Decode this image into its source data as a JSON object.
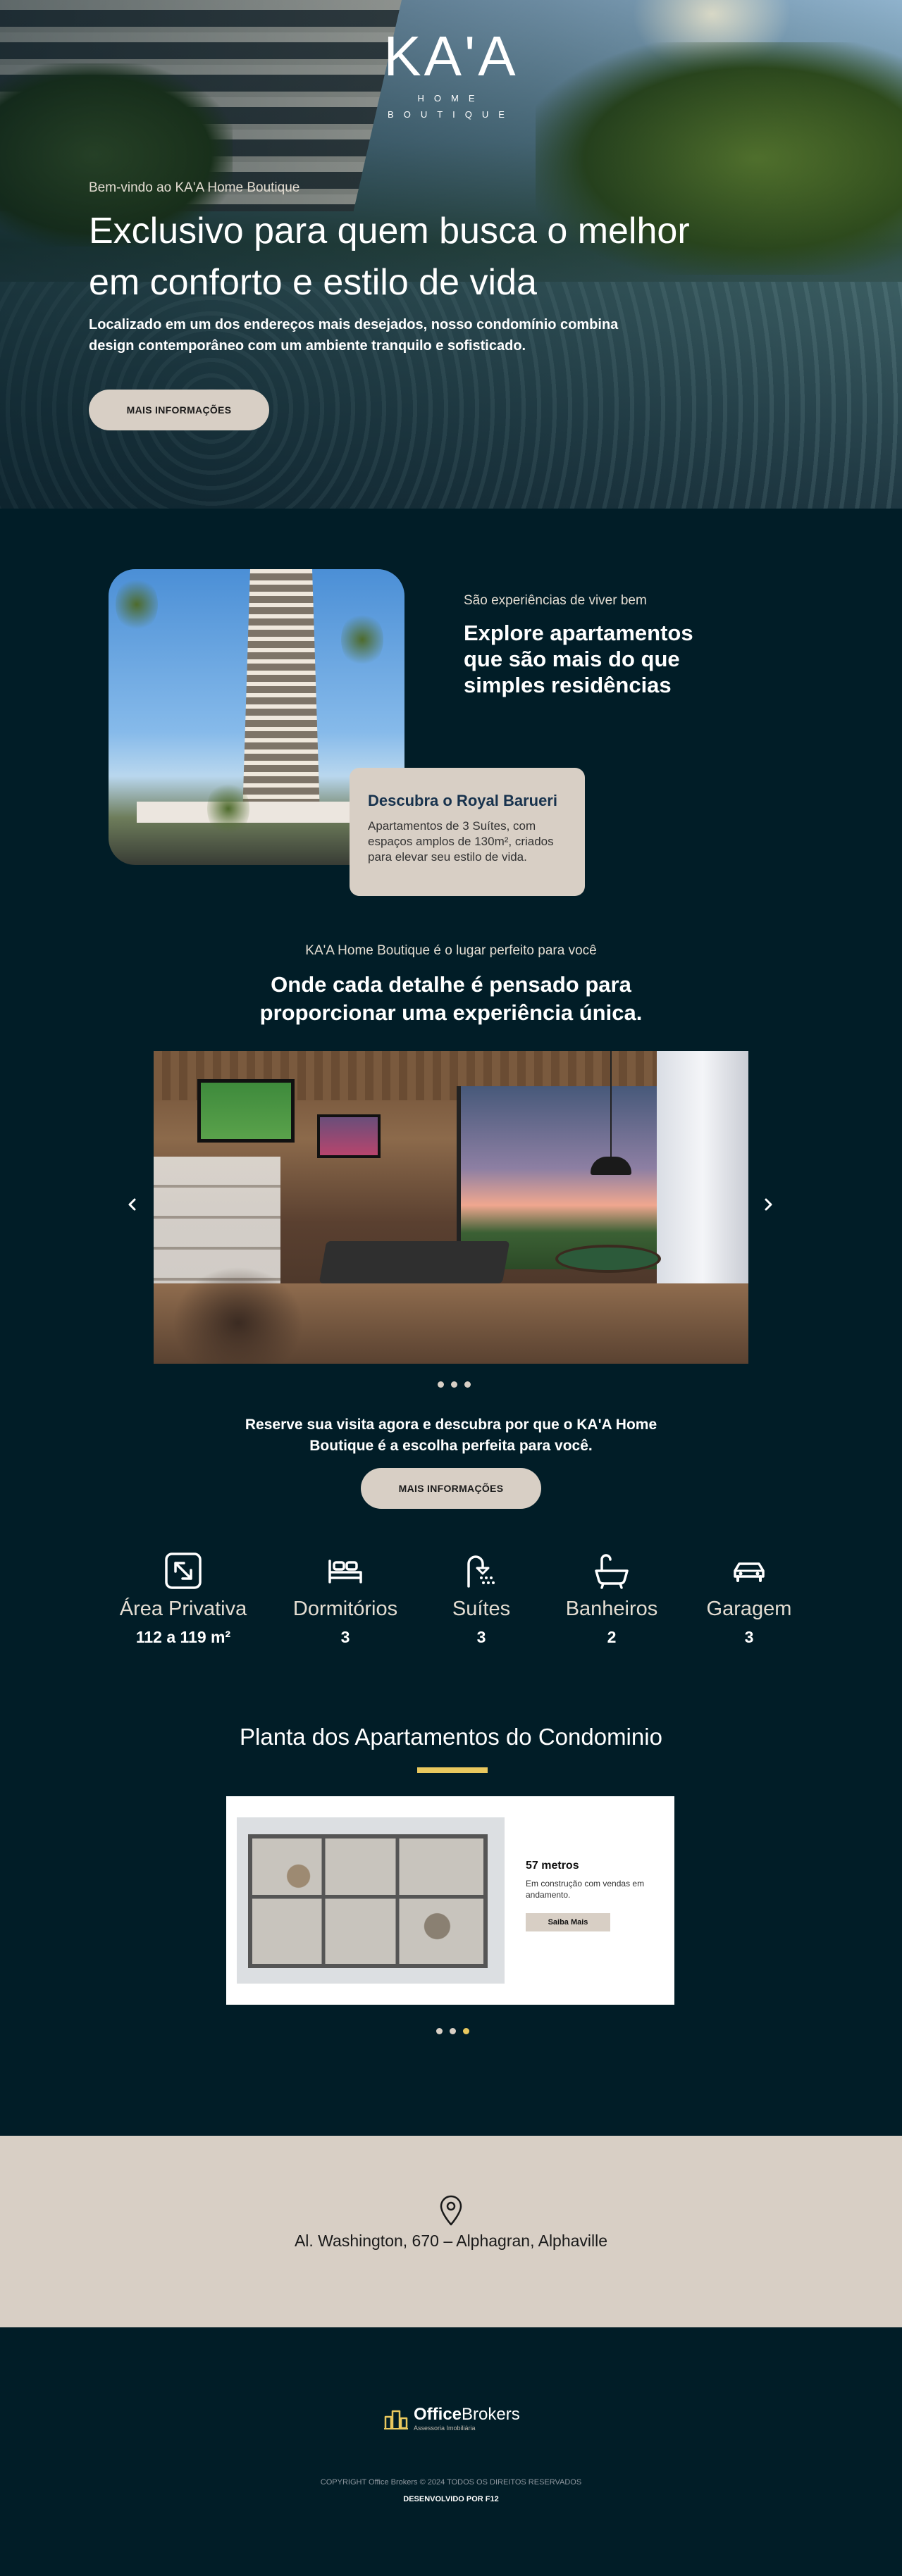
{
  "hero": {
    "logo_text": "KA'A",
    "logo_sub": "HOME BOUTIQUE",
    "eyebrow": "Bem-vindo ao KA'A Home Boutique",
    "title": "Exclusivo para quem busca o melhor em conforto e estilo de vida",
    "description": "Localizado em um dos endereços mais desejados, nosso condomínio combina design contemporâneo com um ambiente tranquilo e sofisticado.",
    "cta_label": "MAIS INFORMAÇÕES"
  },
  "explore": {
    "eyebrow": "São experiências de viver bem",
    "title": "Explore apartamentos que são mais do que simples residências",
    "card_title": "Descubra o Royal Barueri",
    "card_text": "Apartamentos de 3 Suítes, com espaços amplos de 130m², criados para elevar seu estilo de vida."
  },
  "amenities": {
    "eyebrow": "KA'A Home Boutique é o lugar perfeito para você",
    "title": "Onde cada detalhe é pensado para proporcionar uma experiência única.",
    "prev_icon": "chevron-left-icon",
    "next_icon": "chevron-right-icon",
    "slides_count": 3,
    "active_slide": 1,
    "cta_text": "Reserve sua visita agora e descubra por que o KA'A Home Boutique é a escolha perfeita para você.",
    "cta_label": "MAIS INFORMAÇÕES"
  },
  "features": [
    {
      "icon": "expand-arrows-icon",
      "label": "Área Privativa",
      "value": "112 a 119 m²"
    },
    {
      "icon": "bed-icon",
      "label": "Dormitórios",
      "value": "3"
    },
    {
      "icon": "shower-icon",
      "label": "Suítes",
      "value": "3"
    },
    {
      "icon": "bathtub-icon",
      "label": "Banheiros",
      "value": "2"
    },
    {
      "icon": "car-icon",
      "label": "Garagem",
      "value": "3"
    }
  ],
  "plans": {
    "title": "Planta dos Apartamentos do Condominio",
    "item_title": "57 metros",
    "item_text": "Em construção com vendas em andamento.",
    "item_button": "Saiba Mais",
    "slides_count": 3,
    "active_slide": 3
  },
  "address": {
    "icon": "map-pin-icon",
    "text": "Al. Washington, 670 – Alphagran, Alphaville"
  },
  "footer": {
    "brand_bold": "Office",
    "brand_light": "Brokers",
    "brand_tagline": "Assessoria Imobiliária",
    "copyright": "COPYRIGHT Office Brokers © 2024 TODOS OS DIREITOS RESERVADOS",
    "developer": "DESENVOLVIDO POR F12"
  },
  "colors": {
    "background": "#011d27",
    "accent_beige": "#d8cfc5",
    "accent_gold": "#e9c85e"
  }
}
